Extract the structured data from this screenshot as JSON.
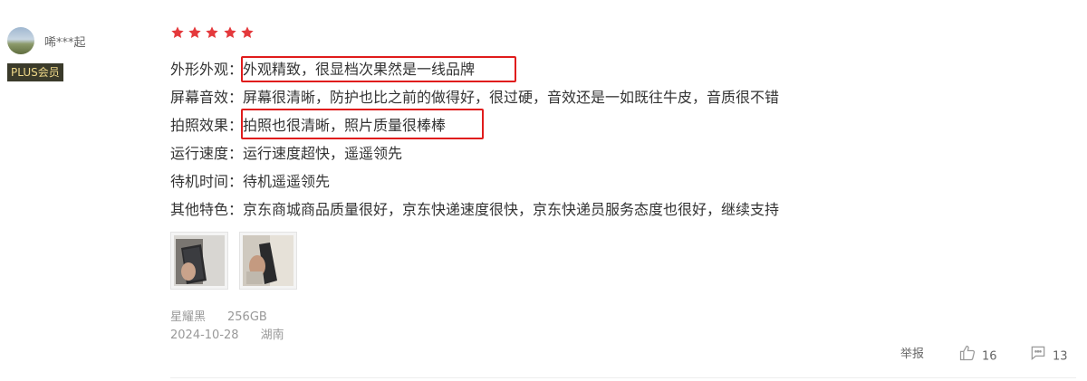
{
  "user": {
    "name": "唏***起",
    "badge": "PLUS会员"
  },
  "review": {
    "rating": 5,
    "rating_max": 5,
    "star_color": "#e4393c",
    "highlight_color": "#e01c1c",
    "lines": [
      {
        "key": "外形外观：",
        "value": "外观精致，很显档次果然是一线品牌"
      },
      {
        "key": "屏幕音效：",
        "value": "屏幕很清晰，防护也比之前的做得好，很过硬，音效还是一如既往牛皮，音质很不错"
      },
      {
        "key": "拍照效果：",
        "value": "拍照也很清晰，照片质量很棒棒"
      },
      {
        "key": "运行速度：",
        "value": "运行速度超快，遥遥领先"
      },
      {
        "key": "待机时间：",
        "value": "待机遥遥领先"
      },
      {
        "key": "其他特色：",
        "value": "京东商城商品质量很好，京东快递速度很快，京东快递员服务态度也很好，继续支持"
      }
    ],
    "images": [
      "phone-photo-1",
      "phone-photo-2"
    ],
    "product_color": "星耀黑",
    "product_storage": "256GB",
    "date": "2024-10-28",
    "location": "湖南"
  },
  "actions": {
    "report": "举报",
    "likes": "16",
    "comments": "13"
  }
}
